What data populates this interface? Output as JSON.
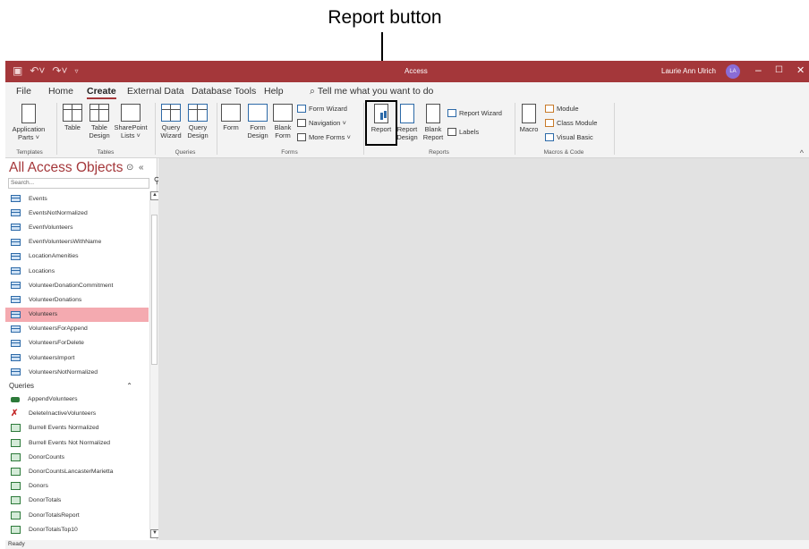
{
  "callout": {
    "label": "Report button"
  },
  "titlebar": {
    "title": "Access",
    "user": "Laurie Ann Ulrich",
    "initials": "LA",
    "minimize": "–",
    "restore": "☐",
    "close": "✕",
    "accent": "#a4373a"
  },
  "tabs": [
    "File",
    "Home",
    "Create",
    "External Data",
    "Database Tools",
    "Help"
  ],
  "tell_me": "Tell me what you want to do",
  "ribbon": {
    "templates": {
      "application_parts": "Application\nParts ˅",
      "group": "Templates"
    },
    "tables": {
      "table": "Table",
      "table_design": "Table\nDesign",
      "sharepoint": "SharePoint\nLists ˅",
      "group": "Tables"
    },
    "queries": {
      "query_wizard": "Query\nWizard",
      "query_design": "Query\nDesign",
      "group": "Queries"
    },
    "forms": {
      "form": "Form",
      "form_design": "Form\nDesign",
      "blank_form": "Blank\nForm",
      "form_wizard": "Form Wizard",
      "navigation": "Navigation ˅",
      "more_forms": "More Forms ˅",
      "group": "Forms"
    },
    "reports": {
      "report": "Report",
      "report_design": "Report\nDesign",
      "blank_report": "Blank\nReport",
      "report_wizard": "Report Wizard",
      "labels": "Labels",
      "group": "Reports"
    },
    "macros": {
      "macro": "Macro",
      "module": "Module",
      "class_module": "Class Module",
      "visual_basic": "Visual Basic",
      "group": "Macros & Code"
    }
  },
  "nav": {
    "title": "All Access Objects",
    "search_placeholder": "Search...",
    "tables": [
      "Events",
      "EventsNotNormalized",
      "EventVolunteers",
      "EventVolunteersWithName",
      "LocationAmenities",
      "Locations",
      "VolunteerDonationCommitment",
      "VolunteerDonations",
      "Volunteers",
      "VolunteersForAppend",
      "VolunteersForDelete",
      "VolunteersImport",
      "VolunteersNotNormalized"
    ],
    "selected": "Volunteers",
    "queries_group": "Queries",
    "queries": [
      "AppendVolunteers",
      "DeleteInactiveVolunteers",
      "Burrell Events Normalized",
      "Burrell Events Not Normalized",
      "DonorCounts",
      "DonorCountsLancasterMarietta",
      "Donors",
      "DonorTotals",
      "DonorTotalsReport",
      "DonorTotalsTop10"
    ]
  },
  "status": {
    "text": "Ready"
  }
}
